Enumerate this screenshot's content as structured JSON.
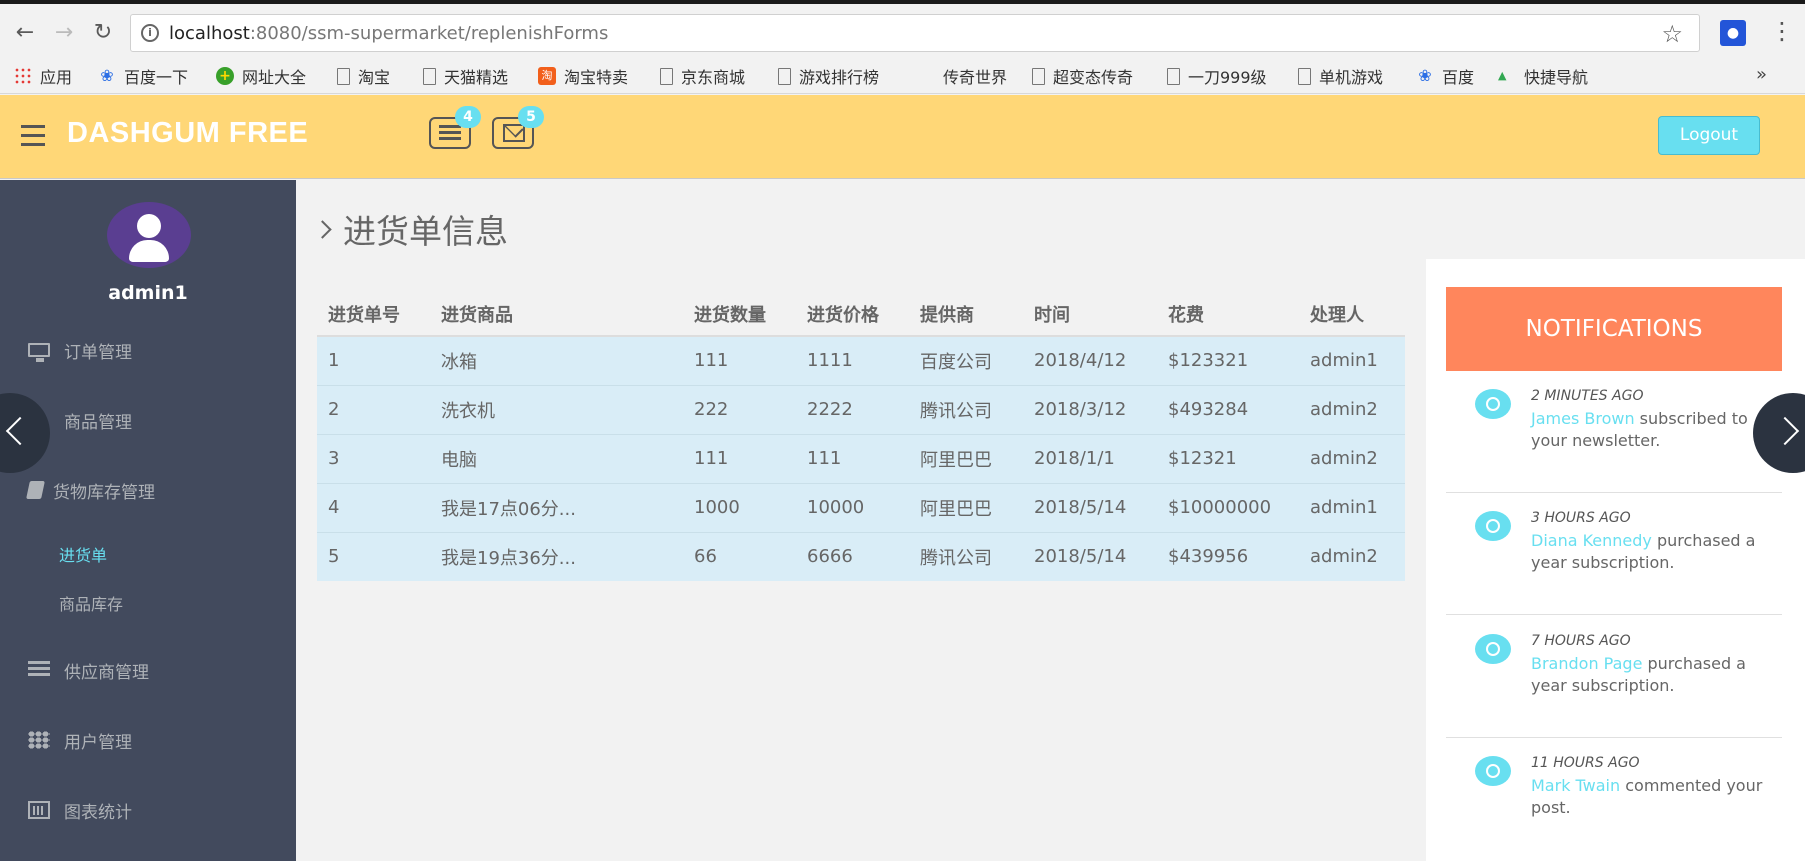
{
  "browser": {
    "url_host": "localhost",
    "url_path": ":8080/ssm-supermarket/replenishForms",
    "bookmarks": [
      "应用",
      "百度一下",
      "网址大全",
      "淘宝",
      "天猫精选",
      "淘宝特卖",
      "京东商城",
      "游戏排行榜",
      "传奇世界",
      "超变态传奇",
      "一刀999级",
      "单机游戏",
      "百度",
      "快捷导航"
    ],
    "more": "»"
  },
  "header": {
    "logo": "DASHGUM FREE",
    "tasks_badge": "4",
    "mail_badge": "5",
    "logout_label": "Logout"
  },
  "sidebar": {
    "username": "admin1",
    "items": [
      "订单管理",
      "商品管理",
      "货物库存管理",
      "供应商管理",
      "用户管理",
      "图表统计"
    ],
    "sub_items": [
      "进货单",
      "商品库存"
    ]
  },
  "main": {
    "title": "进货单信息",
    "columns": [
      "进货单号",
      "进货商品",
      "进货数量",
      "进货价格",
      "提供商",
      "时间",
      "花费",
      "处理人"
    ],
    "rows": [
      [
        "1",
        "冰箱",
        "111",
        "1111",
        "百度公司",
        "2018/4/12",
        "$123321",
        "admin1"
      ],
      [
        "2",
        "洗衣机",
        "222",
        "2222",
        "腾讯公司",
        "2018/3/12",
        "$493284",
        "admin2"
      ],
      [
        "3",
        "电脑",
        "111",
        "111",
        "阿里巴巴",
        "2018/1/1",
        "$12321",
        "admin2"
      ],
      [
        "4",
        "我是17点06分...",
        "1000",
        "10000",
        "阿里巴巴",
        "2018/5/14",
        "$10000000",
        "admin1"
      ],
      [
        "5",
        "我是19点36分...",
        "66",
        "6666",
        "腾讯公司",
        "2018/5/14",
        "$439956",
        "admin2"
      ]
    ]
  },
  "notifications": {
    "title": "NOTIFICATIONS",
    "items": [
      {
        "time": "2 MINUTES AGO",
        "name": "James Brown",
        "text": " subscribed to your newsletter."
      },
      {
        "time": "3 HOURS AGO",
        "name": "Diana Kennedy",
        "text": " purchased a year subscription."
      },
      {
        "time": "7 HOURS AGO",
        "name": "Brandon Page",
        "text": " purchased a year subscription."
      },
      {
        "time": "11 HOURS AGO",
        "name": "Mark Twain",
        "text": " commented your post."
      }
    ]
  },
  "colors": {
    "header": "#ffd777",
    "sidebar": "#424a5d",
    "accent": "#68dff0",
    "notif_head": "#ff865c",
    "row": "#d9edf7"
  }
}
